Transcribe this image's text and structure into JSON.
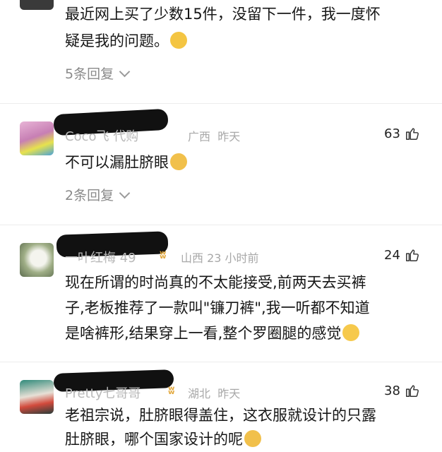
{
  "comment0": {
    "line1": "最近网上买了少数15件，没留下一件，我一度怀",
    "line2": "疑是我的问题。",
    "emoji": "laughing-crying-emoji",
    "replies": "5条回复"
  },
  "comment1": {
    "name": "Coco飞",
    "name_tail": "代购",
    "location": "广西",
    "time": "昨天",
    "likes": "63",
    "text": "不可以漏肚脐眼",
    "emoji": "cat-emoji",
    "replies": "2条回复"
  },
  "comment2": {
    "name": "一叶红梅",
    "level": "49",
    "location": "山西",
    "time": "23 小时前",
    "likes": "24",
    "line1": "现在所谓的时尚真的不太能接受,前两天去买裤",
    "line2": "子,老板推荐了一款叫\"镰刀裤\",我一听都不知道",
    "line3": "是啥裤形,结果穿上一看,整个罗圈腿的感觉",
    "emoji": "grin-emoji"
  },
  "comment3": {
    "name": "Pretty七哥哥",
    "location": "湖北",
    "time": "昨天",
    "likes": "38",
    "line1": "老祖宗说，肚脐眼得盖住，这衣服就设计的只露",
    "line2": "肚脐眼，哪个国家设计的呢",
    "emoji": "cat-emoji"
  },
  "colors": {
    "accent_vip": "#e2a73a",
    "muted": "#8a8a8a"
  }
}
